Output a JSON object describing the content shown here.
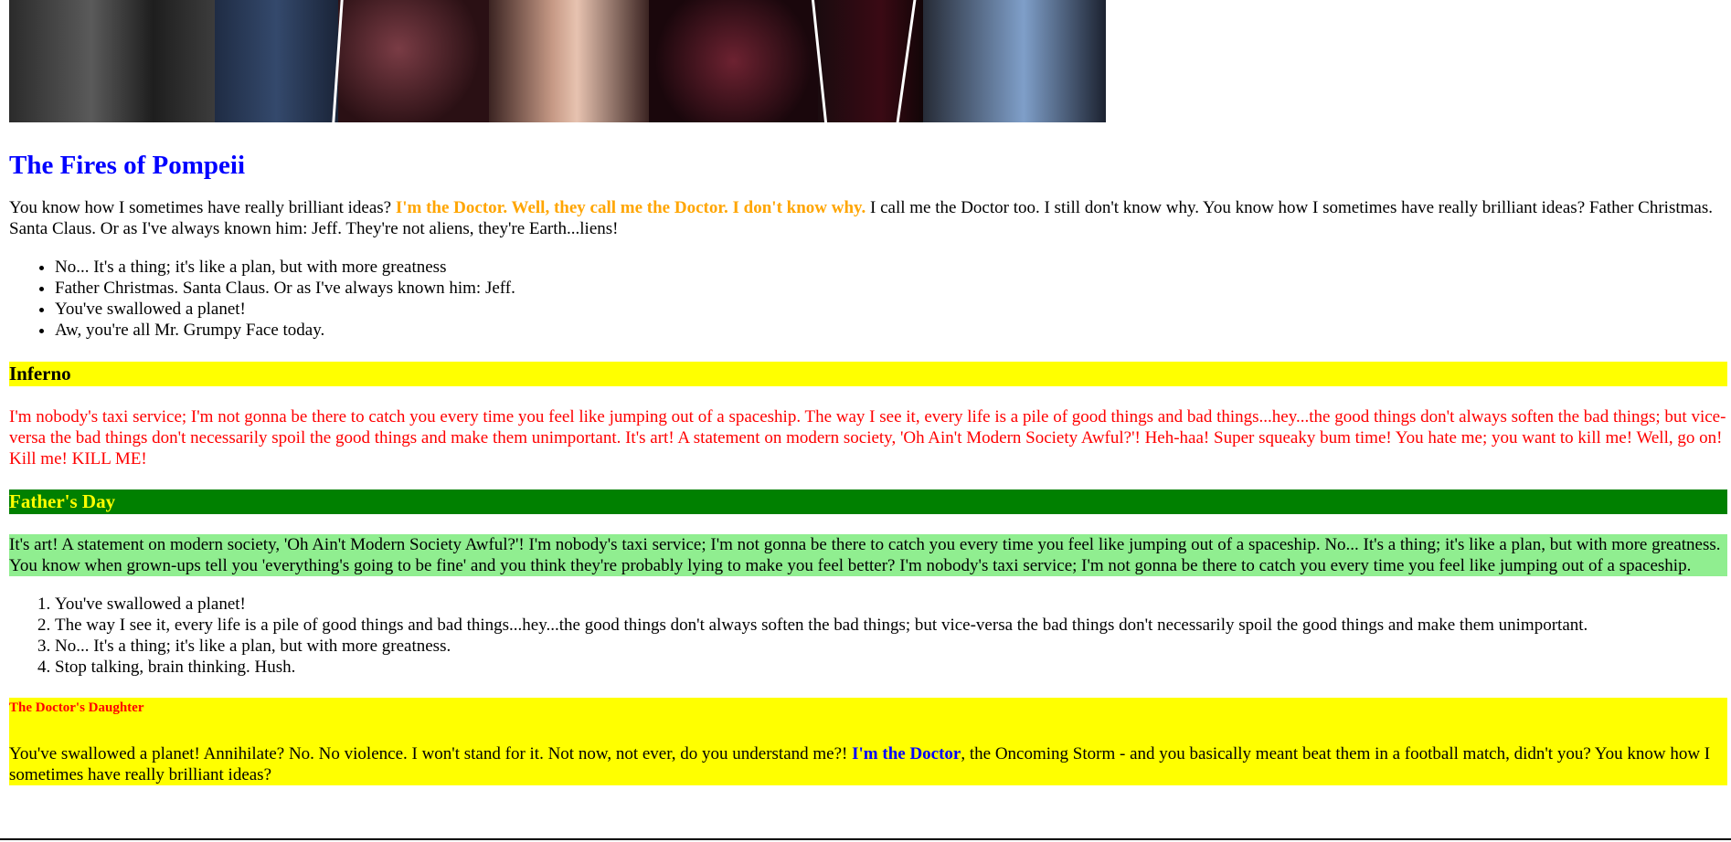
{
  "title": "The Fires of Pompeii",
  "intro": {
    "part1": "You know how I sometimes have really brilliant ideas? ",
    "highlight": "I'm the Doctor. Well, they call me the Doctor. I don't know why.",
    "part2": " I call me the Doctor too. I still don't know why. You know how I sometimes have really brilliant ideas? Father Christmas. Santa Claus. Or as I've always known him: Jeff. They're not aliens, they're Earth...liens!"
  },
  "bullets": [
    "No... It's a thing; it's like a plan, but with more greatness",
    "Father Christmas. Santa Claus. Or as I've always known him: Jeff.",
    "You've swallowed a planet!",
    "Aw, you're all Mr. Grumpy Face today."
  ],
  "inferno": {
    "heading": "Inferno",
    "text": "I'm nobody's taxi service; I'm not gonna be there to catch you every time you feel like jumping out of a spaceship. The way I see it, every life is a pile of good things and bad things...hey...the good things don't always soften the bad things; but vice-versa the bad things don't necessarily spoil the good things and make them unimportant. It's art! A statement on modern society, 'Oh Ain't Modern Society Awful?'! Heh-haa! Super squeaky bum time! You hate me; you want to kill me! Well, go on! Kill me! KILL ME!"
  },
  "fathers_day": {
    "heading": "Father's Day",
    "text": "It's art! A statement on modern society, 'Oh Ain't Modern Society Awful?'! I'm nobody's taxi service; I'm not gonna be there to catch you every time you feel like jumping out of a spaceship. No... It's a thing; it's like a plan, but with more greatness. You know when grown-ups tell you 'everything's going to be fine' and you think they're probably lying to make you feel better? I'm nobody's taxi service; I'm not gonna be there to catch you every time you feel like jumping out of a spaceship."
  },
  "ordered": [
    "You've swallowed a planet!",
    "The way I see it, every life is a pile of good things and bad things...hey...the good things don't always soften the bad things; but vice-versa the bad things don't necessarily spoil the good things and make them unimportant.",
    "No... It's a thing; it's like a plan, but with more greatness.",
    "Stop talking, brain thinking. Hush."
  ],
  "daughter": {
    "heading": "The Doctor's Daughter",
    "part1": "You've swallowed a planet! Annihilate? No. No violence. I won't stand for it. Not now, not ever, do you understand me?! ",
    "highlight": "I'm the Doctor",
    "part2": ", the Oncoming Storm - and you basically meant beat them in a football match, didn't you? You know how I sometimes have really brilliant ideas?"
  },
  "colors": {
    "title": "#0000ff",
    "orange_highlight": "#ffa500",
    "inferno_bg": "#ffff00",
    "inferno_text": "#ff0000",
    "fathers_day_bg": "#008000",
    "fathers_day_text": "#ffff00",
    "fathers_para_bg": "#90ee90",
    "daughter_bg": "#ffff00",
    "daughter_heading": "#ff0000",
    "blue_highlight": "#0000ff"
  }
}
